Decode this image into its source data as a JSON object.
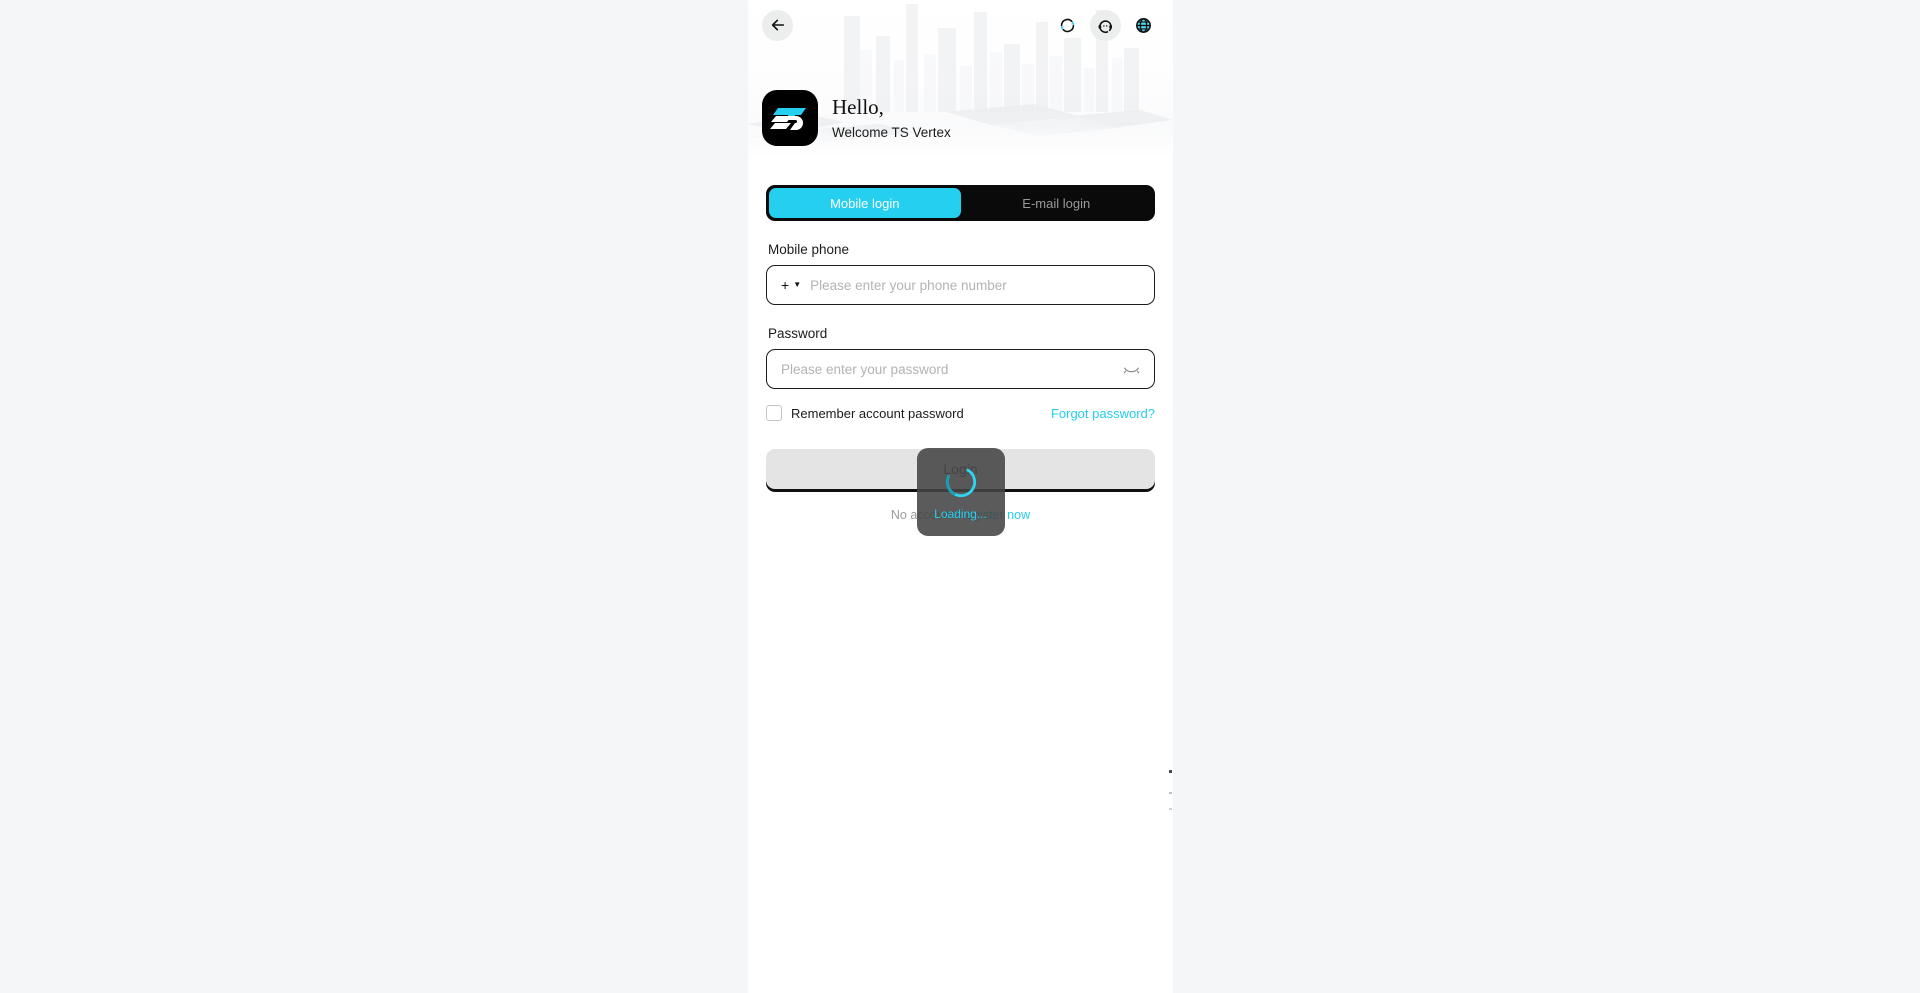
{
  "theme": {
    "accent": "#25cfef",
    "page_background": "#f4f6f8",
    "panel_background": "#ffffff",
    "tab_track": "#0a0a0a",
    "button_disabled": "#e4e4e4",
    "toast_background": "rgba(68,68,68,0.88)"
  },
  "header": {
    "back_button_label": "Back",
    "icons": [
      {
        "name": "refresh-icon",
        "label": "Refresh"
      },
      {
        "name": "support-icon",
        "label": "Customer service"
      },
      {
        "name": "language-globe-icon",
        "label": "Language"
      }
    ],
    "greeting": "Hello,",
    "welcome": "Welcome TS Vertex",
    "logo_text": "TS"
  },
  "tabs": [
    {
      "label": "Mobile login",
      "active": true
    },
    {
      "label": "E-mail login",
      "active": false
    }
  ],
  "form": {
    "phone": {
      "label": "Mobile phone",
      "country_prefix": "+",
      "placeholder": "Please enter your phone number",
      "value": ""
    },
    "password": {
      "label": "Password",
      "placeholder": "Please enter your password",
      "value": "",
      "toggle_icon": "eye-off-icon"
    },
    "remember": {
      "label": "Remember account password",
      "checked": false
    },
    "forgot_link": "Forgot password?",
    "submit_label": "Login"
  },
  "footer": {
    "no_account_text": "No account",
    "register_link": "Register now"
  },
  "overlay": {
    "visible": true,
    "text": "Loading..."
  }
}
